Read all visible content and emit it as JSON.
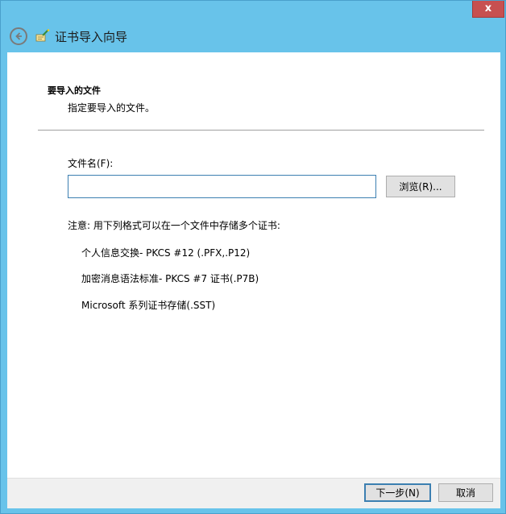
{
  "window": {
    "title": "证书导入向导",
    "close_label": "x"
  },
  "page": {
    "section_title": "要导入的文件",
    "section_desc": "指定要导入的文件。",
    "filename_label": "文件名(F):",
    "filename_value": "",
    "browse_label": "浏览(R)...",
    "note": "注意: 用下列格式可以在一个文件中存储多个证书:",
    "formats": [
      "个人信息交换- PKCS #12 (.PFX,.P12)",
      "加密消息语法标准- PKCS #7 证书(.P7B)",
      "Microsoft 系列证书存储(.SST)"
    ]
  },
  "footer": {
    "next_label": "下一步(N)",
    "cancel_label": "取消"
  },
  "icons": {
    "back": "back-arrow-icon",
    "wizard": "certificate-wizard-icon"
  },
  "colors": {
    "titlebar": "#68c3ea",
    "close": "#c75050",
    "focus": "#3c7fb1"
  }
}
